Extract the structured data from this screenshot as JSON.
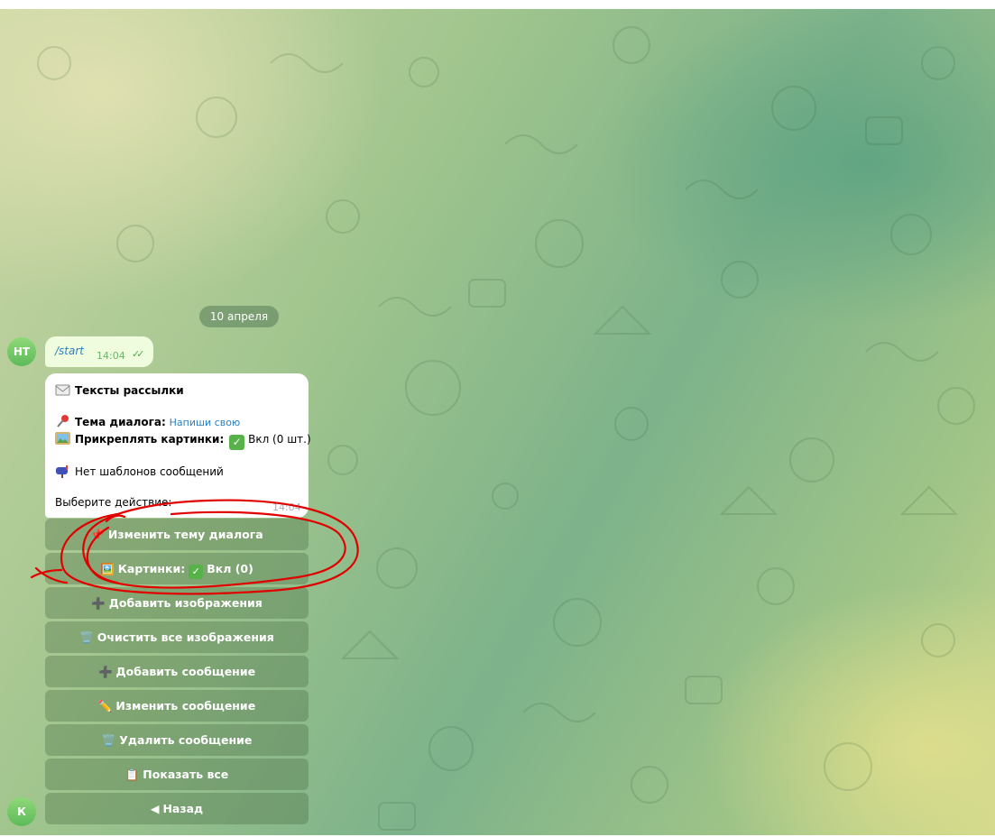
{
  "date_divider": "10 апреля",
  "avatars": {
    "top": "НТ",
    "bottom": "К"
  },
  "user_message": {
    "text": "/start",
    "time": "14:04",
    "status_icon": "double-check-icon"
  },
  "bot_message": {
    "title": "Тексты рассылки",
    "topic_label": "Тема диалога:",
    "topic_value": "Напиши   свою",
    "pin_images_label": "Прикреплять картинки:",
    "pin_images_value": "Вкл (0 шт.)",
    "templates_text": "Нет шаблонов сообщений",
    "prompt": "Выберите действие:",
    "time": "14:04"
  },
  "keyboard": [
    {
      "icon": "pushpin-icon",
      "glyph": "📌",
      "label": "Изменить тему диалога"
    },
    {
      "icon": "picture-icon",
      "glyph": "🖼️",
      "label": "Картинки:",
      "check": "✓",
      "value": "Вкл (0)"
    },
    {
      "icon": "plus-icon",
      "glyph": "➕",
      "label": "Добавить изображения"
    },
    {
      "icon": "trash-icon",
      "glyph": "🗑️",
      "label": "Очистить все изображения"
    },
    {
      "icon": "plus-icon",
      "glyph": "➕",
      "label": "Добавить сообщение"
    },
    {
      "icon": "pencil-icon",
      "glyph": "✏️",
      "label": "Изменить сообщение"
    },
    {
      "icon": "trash-icon",
      "glyph": "🗑️",
      "label": "Удалить сообщение"
    },
    {
      "icon": "clipboard-icon",
      "glyph": "📋",
      "label": "Показать все"
    },
    {
      "icon": "back-arrow-icon",
      "glyph": "◀",
      "label": "Назад"
    }
  ],
  "colors": {
    "bubble_out": "#effdde",
    "link": "#2a7fc4",
    "annotation": "#e00000"
  }
}
